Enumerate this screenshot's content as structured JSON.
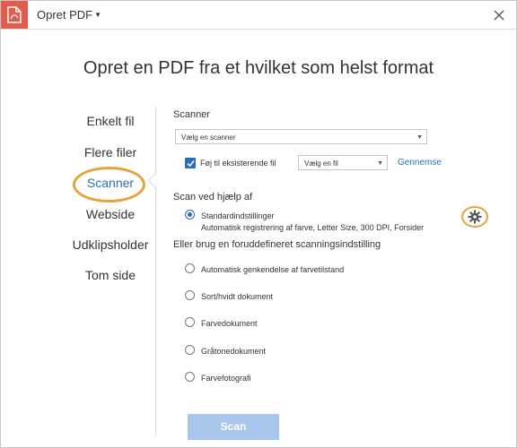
{
  "app": {
    "title": "Opret PDF",
    "icon": "pdf-icon"
  },
  "heading": "Opret en PDF fra et hvilket som helst format",
  "nav": {
    "items": [
      {
        "label": "Enkelt fil"
      },
      {
        "label": "Flere filer"
      },
      {
        "label": "Scanner"
      },
      {
        "label": "Webside"
      },
      {
        "label": "Udklipsholder"
      },
      {
        "label": "Tom side"
      }
    ],
    "active_index": 2
  },
  "scanner": {
    "section_label": "Scanner",
    "select_value": "Vælg en scanner",
    "append_checkbox_label": "Føj til eksisterende fil",
    "append_checked": true,
    "file_select_value": "Vælg en fil",
    "browse_label": "Gennemse"
  },
  "scan_using": {
    "section_label": "Scan ved hjælp af",
    "default_option_label": "Standardindstillinger",
    "default_option_desc": "Automatisk registrering af farve, Letter Size, 300 DPI, Forsider",
    "default_selected": true
  },
  "presets": {
    "section_label": "Eller brug en foruddefineret scanningsindstilling",
    "options": [
      {
        "label": "Automatisk genkendelse af farvetilstand"
      },
      {
        "label": "Sort/hvidt dokument"
      },
      {
        "label": "Farvedokument"
      },
      {
        "label": "Gråtonedokument"
      },
      {
        "label": "Farvefotografi"
      }
    ]
  },
  "scan_button": {
    "label": "Scan",
    "enabled": false
  },
  "colors": {
    "accent": "#2a6ebb",
    "highlight": "#e8a23c",
    "app_icon_bg": "#e05c4d",
    "button_disabled": "#a9c6ec"
  }
}
